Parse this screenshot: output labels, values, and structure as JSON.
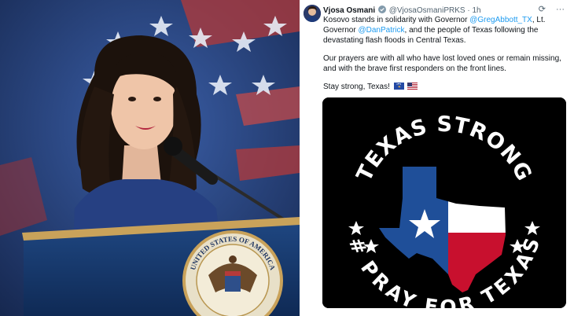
{
  "tweet": {
    "display_name": "Vjosa Osmani",
    "handle": "@VjosaOsmaniPRKS",
    "time": "1h",
    "body_1_pre": "Kosovo stands in solidarity with Governor ",
    "mention_1": "@GregAbbott_TX",
    "body_1_mid": ", Lt. Governor ",
    "mention_2": "@DanPatrick",
    "body_1_post": ", and the people of Texas following the devastating flash floods in Central Texas.",
    "body_2": "Our prayers are with all who have lost loved ones or remain missing, and with the brave first responders on the front lines.",
    "body_3": "Stay strong, Texas!",
    "icons": [
      "verified-icon",
      "grok-icon",
      "more-icon",
      "kosovo-flag-icon",
      "us-flag-icon"
    ]
  },
  "graphic": {
    "top_text": "TEXAS STRONG",
    "bottom_text": "# PRAY FOR TEXAS",
    "colors": {
      "blue": "#1f4f99",
      "red": "#c8102e",
      "white": "#ffffff",
      "black": "#000000"
    }
  },
  "podium": {
    "seal_top": "UNITED STATES OF AMERICA",
    "colors": {
      "podium": "#1a3a6e",
      "trim": "#c9a25a"
    }
  }
}
